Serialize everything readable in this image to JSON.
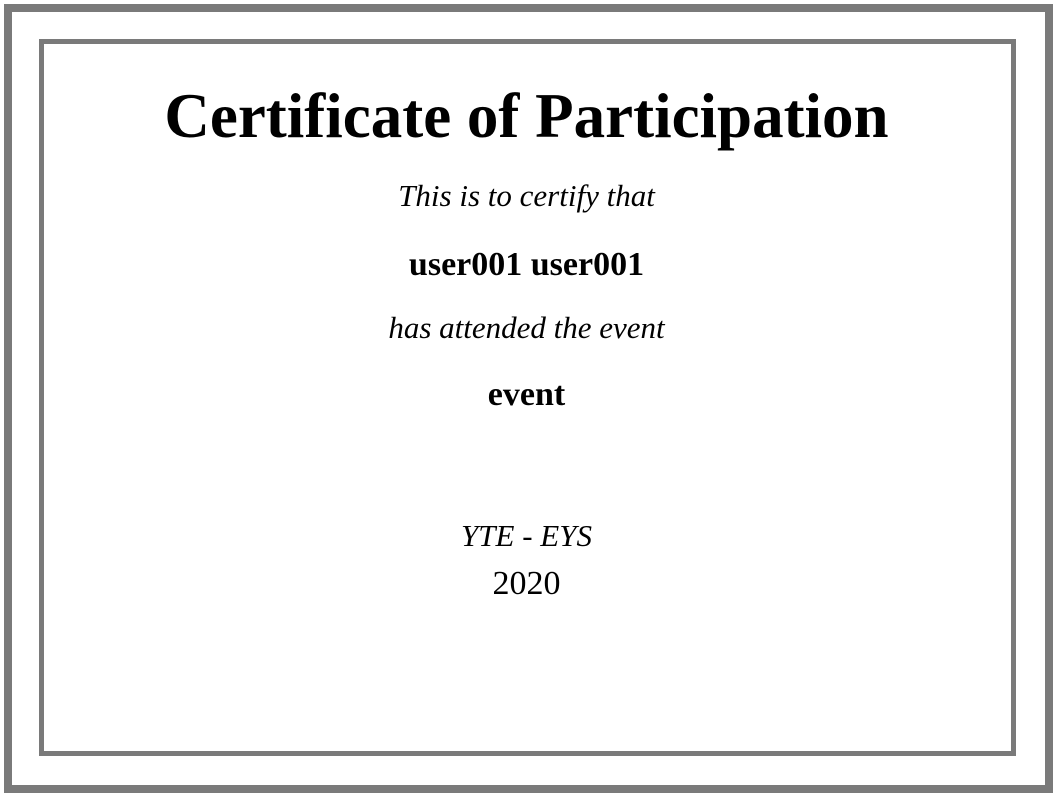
{
  "certificate": {
    "title": "Certificate of Participation",
    "certify_text": "This is to certify that",
    "recipient_name": "user001 user001",
    "attended_text": "has attended the event",
    "event_name": "event",
    "organizer": "YTE - EYS",
    "year": "2020",
    "border_color": "#7a7a7a"
  }
}
